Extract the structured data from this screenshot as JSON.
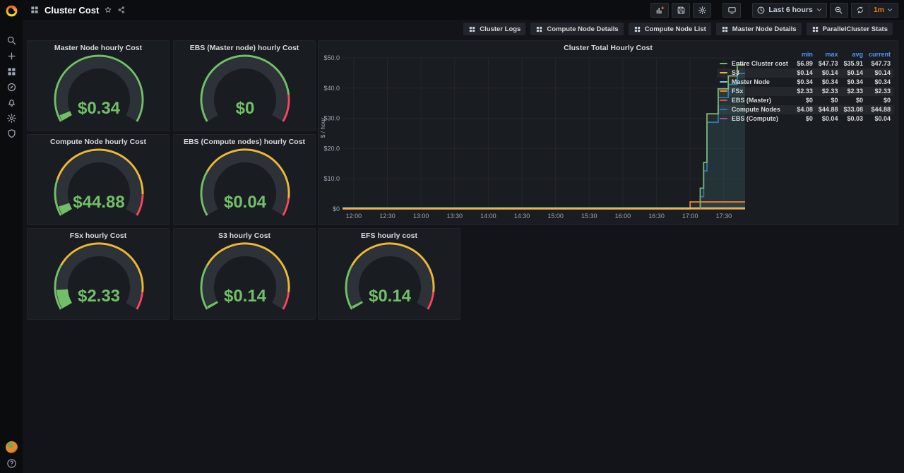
{
  "app": {
    "breadcrumb_title": "Cluster Cost"
  },
  "topbar": {
    "action_icons": [
      "panel-add-icon",
      "save-icon",
      "settings-icon",
      "tv-icon"
    ],
    "time_range_label": "Last 6 hours",
    "refresh_interval": "1m",
    "refresh_interval_color": "#eb7b18"
  },
  "submenu_links": [
    {
      "icon": "apps-icon",
      "label": "Cluster Logs"
    },
    {
      "icon": "apps-icon",
      "label": "Compute Node Details"
    },
    {
      "icon": "apps-icon",
      "label": "Compute Node List"
    },
    {
      "icon": "apps-icon",
      "label": "Master Node Details"
    },
    {
      "icon": "apps-icon",
      "label": "ParallelCluster Stats"
    }
  ],
  "sidebar_items": [
    {
      "icon": "search-icon",
      "name": "search"
    },
    {
      "icon": "plus-icon",
      "name": "create"
    },
    {
      "icon": "apps-icon",
      "name": "dashboards"
    },
    {
      "icon": "compass-icon",
      "name": "explore"
    },
    {
      "icon": "bell-icon",
      "name": "alerting"
    },
    {
      "icon": "gear-icon",
      "name": "configuration"
    },
    {
      "icon": "shield-icon",
      "name": "server-admin"
    }
  ],
  "gauge_colors": {
    "green": "#73BF69",
    "yellow": "#EAB839",
    "red": "#F2495C",
    "track": "#2d3138"
  },
  "gauges": [
    {
      "title": "Master Node hourly Cost",
      "value": "$0.34",
      "fill": 0.034,
      "segments": [
        {
          "color": "#73BF69",
          "from": 0,
          "to": 1
        }
      ]
    },
    {
      "title": "EBS (Master node) hourly Cost",
      "value": "$0",
      "fill": 0,
      "segments": [
        {
          "color": "#73BF69",
          "from": 0,
          "to": 0.85
        },
        {
          "color": "#F2495C",
          "from": 0.85,
          "to": 1
        }
      ]
    },
    {
      "title": "Compute Node hourly Cost",
      "value": "$44.88",
      "fill": 0.05,
      "segments": [
        {
          "color": "#73BF69",
          "from": 0,
          "to": 0.2
        },
        {
          "color": "#EAB839",
          "from": 0.2,
          "to": 0.88
        },
        {
          "color": "#F2495C",
          "from": 0.88,
          "to": 1
        }
      ]
    },
    {
      "title": "EBS (Compute nodes) hourly Cost",
      "value": "$0.04",
      "fill": 0,
      "segments": [
        {
          "color": "#73BF69",
          "from": 0,
          "to": 0.25
        },
        {
          "color": "#EAB839",
          "from": 0.25,
          "to": 0.9
        },
        {
          "color": "#F2495C",
          "from": 0.9,
          "to": 1
        }
      ]
    },
    {
      "title": "FSx hourly Cost",
      "value": "$2.33",
      "fill": 0.11,
      "segments": [
        {
          "color": "#73BF69",
          "from": 0,
          "to": 0.25
        },
        {
          "color": "#EAB839",
          "from": 0.25,
          "to": 0.9
        },
        {
          "color": "#F2495C",
          "from": 0.9,
          "to": 1
        }
      ]
    },
    {
      "title": "S3 hourly Cost",
      "value": "$0.14",
      "fill": 0.015,
      "segments": [
        {
          "color": "#73BF69",
          "from": 0,
          "to": 0.25
        },
        {
          "color": "#EAB839",
          "from": 0.25,
          "to": 0.9
        },
        {
          "color": "#F2495C",
          "from": 0.9,
          "to": 1
        }
      ]
    },
    {
      "title": "EFS hourly cost",
      "value": "$0.14",
      "fill": 0.015,
      "segments": [
        {
          "color": "#73BF69",
          "from": 0,
          "to": 0.25
        },
        {
          "color": "#EAB839",
          "from": 0.25,
          "to": 0.9
        },
        {
          "color": "#F2495C",
          "from": 0.9,
          "to": 1
        }
      ]
    }
  ],
  "chart_data": {
    "type": "line",
    "title": "Cluster Total Hourly Cost",
    "ylabel": "$ / hour",
    "ylim": [
      0,
      50
    ],
    "x_domain_minutes": [
      710,
      1069
    ],
    "y_ticks": [
      {
        "v": 0,
        "label": "$0"
      },
      {
        "v": 10,
        "label": "$10.0"
      },
      {
        "v": 20,
        "label": "$20.0"
      },
      {
        "v": 30,
        "label": "$30.0"
      },
      {
        "v": 40,
        "label": "$40.0"
      },
      {
        "v": 50,
        "label": "$50.0"
      }
    ],
    "x_ticks": [
      {
        "t": 720,
        "label": "12:00"
      },
      {
        "t": 750,
        "label": "12:30"
      },
      {
        "t": 780,
        "label": "13:00"
      },
      {
        "t": 810,
        "label": "13:30"
      },
      {
        "t": 840,
        "label": "14:00"
      },
      {
        "t": 870,
        "label": "14:30"
      },
      {
        "t": 900,
        "label": "15:00"
      },
      {
        "t": 930,
        "label": "15:30"
      },
      {
        "t": 960,
        "label": "16:00"
      },
      {
        "t": 990,
        "label": "16:30"
      },
      {
        "t": 1020,
        "label": "17:00"
      },
      {
        "t": 1050,
        "label": "17:30"
      }
    ],
    "legend_columns": [
      "min",
      "max",
      "avg",
      "current"
    ],
    "grid": true,
    "legend_position": "right-table",
    "series": [
      {
        "name": "Entire Cluster cost",
        "color": "#7EB26D",
        "fill": true,
        "stats": {
          "min": "$6.89",
          "max": "$47.73",
          "avg": "$35.91",
          "current": "$47.73"
        },
        "points": [
          [
            1029,
            0
          ],
          [
            1029,
            6.89
          ],
          [
            1032,
            15.4
          ],
          [
            1035,
            31.5
          ],
          [
            1045,
            39.75
          ],
          [
            1054,
            44.05
          ],
          [
            1062,
            47.73
          ],
          [
            1069,
            47.73
          ]
        ]
      },
      {
        "name": "S3",
        "color": "#EAB839",
        "fill": false,
        "stats": {
          "min": "$0.14",
          "max": "$0.14",
          "avg": "$0.14",
          "current": "$0.14"
        },
        "points": [
          [
            710,
            0.14
          ],
          [
            1069,
            0.14
          ]
        ]
      },
      {
        "name": "Master Node",
        "color": "#6ED0E0",
        "fill": false,
        "stats": {
          "min": "$0.34",
          "max": "$0.34",
          "avg": "$0.34",
          "current": "$0.34"
        },
        "points": [
          [
            710,
            0.34
          ],
          [
            1069,
            0.34
          ]
        ]
      },
      {
        "name": "FSx",
        "color": "#EF843C",
        "fill": true,
        "stats": {
          "min": "$2.33",
          "max": "$2.33",
          "avg": "$2.33",
          "current": "$2.33"
        },
        "points": [
          [
            710,
            0
          ],
          [
            1020,
            0
          ],
          [
            1020,
            2.33
          ],
          [
            1069,
            2.33
          ]
        ]
      },
      {
        "name": "EBS (Master)",
        "color": "#E24D42",
        "fill": false,
        "stats": {
          "min": "$0",
          "max": "$0",
          "avg": "$0",
          "current": "$0"
        },
        "points": [
          [
            710,
            0
          ],
          [
            1069,
            0
          ]
        ]
      },
      {
        "name": "Compute Nodes",
        "color": "#1F78C1",
        "fill": true,
        "stats": {
          "min": "$4.08",
          "max": "$44.88",
          "avg": "$33.08",
          "current": "$44.88"
        },
        "points": [
          [
            1029,
            0
          ],
          [
            1029,
            4.08
          ],
          [
            1032,
            12.6
          ],
          [
            1035,
            28.7
          ],
          [
            1045,
            36.9
          ],
          [
            1054,
            41.2
          ],
          [
            1062,
            44.88
          ],
          [
            1069,
            44.88
          ]
        ]
      },
      {
        "name": "EBS (Compute)",
        "color": "#BA43A9",
        "fill": false,
        "stats": {
          "min": "$0",
          "max": "$0.04",
          "avg": "$0.03",
          "current": "$0.04"
        },
        "points": [
          [
            710,
            0
          ],
          [
            1029,
            0
          ],
          [
            1029,
            0.04
          ],
          [
            1069,
            0.04
          ]
        ]
      }
    ]
  }
}
